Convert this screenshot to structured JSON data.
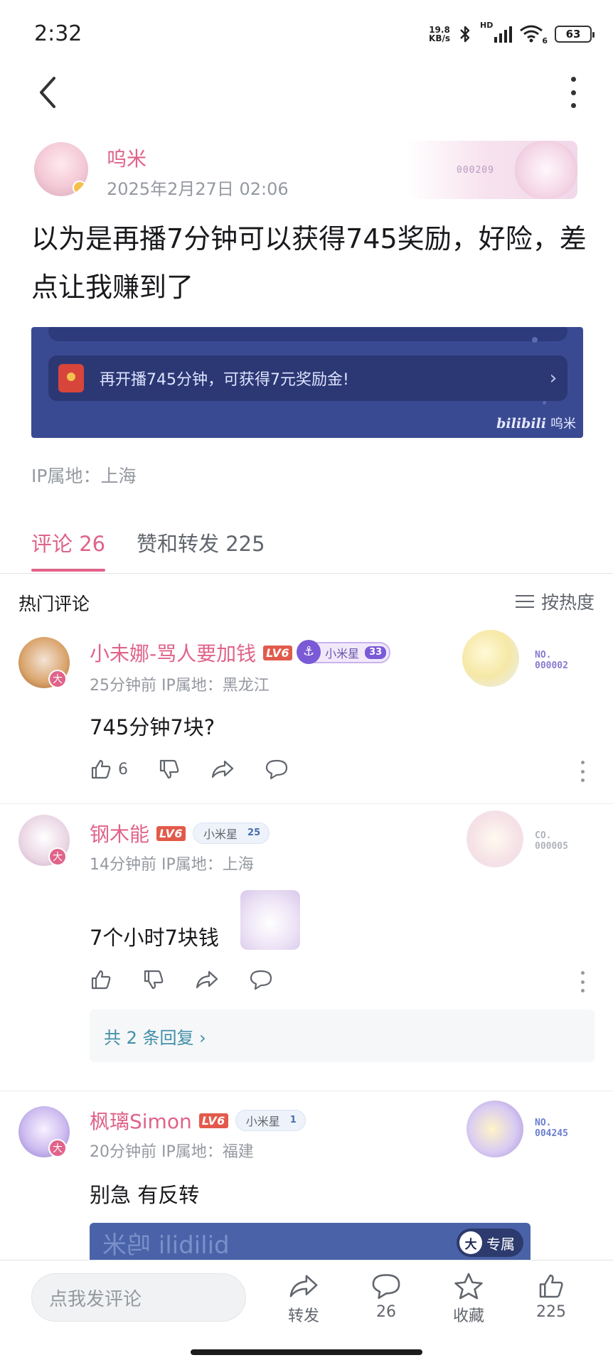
{
  "status_bar": {
    "time": "2:32",
    "net_speed_value": "19.8",
    "net_speed_unit": "KB/s",
    "battery": "63",
    "signal_label": "HD",
    "wifi_label": "6"
  },
  "post": {
    "author_name": "呜米",
    "time": "2025年2月27日 02:06",
    "badge_no": "000209",
    "text": "以为是再播7分钟可以获得745奖励，好险，差点让我赚到了",
    "image": {
      "row_text": "再开播745分钟，可获得7元奖励金!",
      "watermark_logo": "bilibili",
      "watermark_user": "呜米"
    },
    "ip_location": "IP属地：上海"
  },
  "tabs": {
    "comments": "评论 26",
    "likes_and_reposts": "赞和转发 225"
  },
  "section": {
    "hot_title": "热门评论",
    "sort_label": "按热度"
  },
  "comments": [
    {
      "name": "小未娜-骂人要加钱",
      "level": "LV6",
      "fan_name": "小米星",
      "fan_level": "33",
      "meta": "25分钟前 IP属地：黑龙江",
      "text": "745分钟7块?",
      "likes": "6",
      "no_label": "NO.",
      "no_value": "000002",
      "avatar_mark": "大"
    },
    {
      "name": "钢木能",
      "level": "LV6",
      "fan_name": "小米星",
      "fan_level": "25",
      "meta": "14分钟前 IP属地：上海",
      "text": "7个小时7块钱",
      "no_label": "CO.",
      "no_value": "000005",
      "avatar_mark": "大",
      "replies_label": "共 2 条回复 ›"
    },
    {
      "name": "枫璃Simon",
      "level": "LV6",
      "fan_name": "小米星",
      "fan_level": "1",
      "meta": "20分钟前 IP属地：福建",
      "text": "别急 有反转",
      "no_label": "NO.",
      "no_value": "004245",
      "avatar_mark": "大",
      "image_mirrored_text": "bilibili 呜米",
      "exclusive_icon": "大",
      "exclusive_label": "专属"
    }
  ],
  "bottom_bar": {
    "input_placeholder": "点我发评论",
    "repost_label": "转发",
    "comment_count": "26",
    "favorite_label": "收藏",
    "like_count": "225"
  },
  "colors": {
    "accent_pink": "#e0638a",
    "level_red": "#e25a4b",
    "gray_text": "#9499a0",
    "fan_purple": "#7a5ad6"
  },
  "icons": [
    "back-arrow-icon",
    "more-vertical-icon",
    "bluetooth-icon",
    "signal-icon",
    "wifi-icon",
    "battery-icon",
    "thumb-up-icon",
    "thumb-down-icon",
    "share-icon",
    "comment-icon",
    "star-icon",
    "sort-icon",
    "chevron-right-icon",
    "red-packet-icon",
    "anchor-icon"
  ]
}
